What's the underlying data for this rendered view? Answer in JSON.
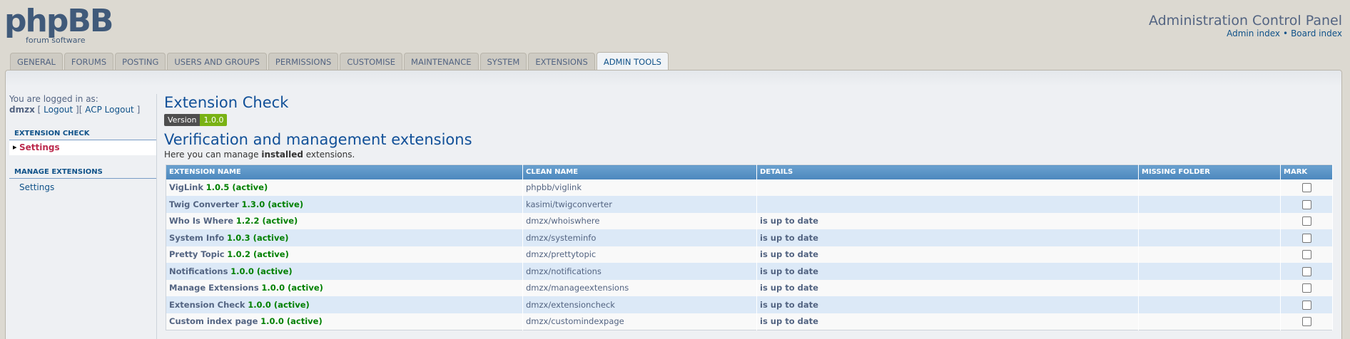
{
  "header": {
    "logo_text": "phpBB",
    "logo_tagline": "forum software",
    "title": "Administration Control Panel",
    "links": [
      "Admin index",
      "Board index"
    ],
    "link_separator": "•"
  },
  "tabs": [
    {
      "label": "General"
    },
    {
      "label": "Forums"
    },
    {
      "label": "Posting"
    },
    {
      "label": "Users and Groups"
    },
    {
      "label": "Permissions"
    },
    {
      "label": "Customise"
    },
    {
      "label": "Maintenance"
    },
    {
      "label": "System"
    },
    {
      "label": "Extensions"
    },
    {
      "label": "Admin Tools",
      "active": true
    }
  ],
  "sidebar": {
    "login_label": "You are logged in as:",
    "username": "dmzx",
    "logout_label": "Logout",
    "acp_logout_label": "ACP Logout",
    "sections": [
      {
        "header": "Extension Check",
        "items": [
          {
            "label": "Settings",
            "active": true
          }
        ]
      },
      {
        "header": "Manage Extensions",
        "items": [
          {
            "label": "Settings",
            "active": false
          }
        ]
      }
    ]
  },
  "content": {
    "title": "Extension Check",
    "version_label": "Version",
    "version_number": "1.0.0",
    "section_title": "Verification and management extensions",
    "desc_prefix": "Here you can manage ",
    "desc_bold": "installed",
    "desc_suffix": " extensions.",
    "table": {
      "columns": [
        "Extension name",
        "Clean name",
        "Details",
        "Missing folder",
        "Mark"
      ],
      "rows": [
        {
          "name": "VigLink",
          "version": "1.0.5 (active)",
          "clean": "phpbb/viglink",
          "details": "",
          "missing": ""
        },
        {
          "name": "Twig Converter",
          "version": "1.3.0 (active)",
          "clean": "kasimi/twigconverter",
          "details": "",
          "missing": ""
        },
        {
          "name": "Who Is Where",
          "version": "1.2.2 (active)",
          "clean": "dmzx/whoiswhere",
          "details": "is up to date",
          "missing": ""
        },
        {
          "name": "System Info",
          "version": "1.0.3 (active)",
          "clean": "dmzx/systeminfo",
          "details": "is up to date",
          "missing": ""
        },
        {
          "name": "Pretty Topic",
          "version": "1.0.2 (active)",
          "clean": "dmzx/prettytopic",
          "details": "is up to date",
          "missing": ""
        },
        {
          "name": "Notifications",
          "version": "1.0.0 (active)",
          "clean": "dmzx/notifications",
          "details": "is up to date",
          "missing": ""
        },
        {
          "name": "Manage Extensions",
          "version": "1.0.0 (active)",
          "clean": "dmzx/manageextensions",
          "details": "is up to date",
          "missing": ""
        },
        {
          "name": "Extension Check",
          "version": "1.0.0 (active)",
          "clean": "dmzx/extensioncheck",
          "details": "is up to date",
          "missing": ""
        },
        {
          "name": "Custom index page",
          "version": "1.0.0 (active)",
          "clean": "dmzx/customindexpage",
          "details": "is up to date",
          "missing": ""
        }
      ]
    }
  },
  "colors": {
    "accent": "#105289",
    "active_link": "#bc2a4d",
    "status_green": "#008000",
    "table_header": "#4c87bd"
  }
}
